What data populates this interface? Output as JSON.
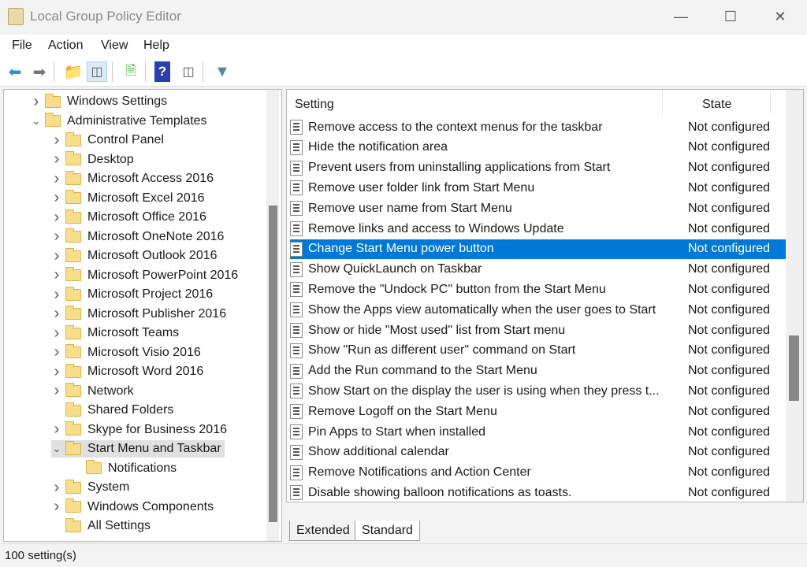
{
  "window": {
    "title": "Local Group Policy Editor",
    "icon": "policy-scroll-icon",
    "controls": [
      "minimize",
      "maximize",
      "close"
    ]
  },
  "menu": [
    {
      "label": "File"
    },
    {
      "label": "Action"
    },
    {
      "label": "View"
    },
    {
      "label": "Help"
    }
  ],
  "toolbar": [
    "back-arrow-icon",
    "forward-arrow-icon",
    "up-folder-icon",
    "show-hide-console-tree-icon",
    "export-list-icon",
    "help-icon",
    "show-action-pane-icon",
    "filter-icon"
  ],
  "tree": [
    {
      "label": "Windows Settings",
      "level": 1,
      "chev": "right"
    },
    {
      "label": "Administrative Templates",
      "level": 1,
      "chev": "down"
    },
    {
      "label": "Control Panel",
      "level": 2,
      "chev": "right"
    },
    {
      "label": "Desktop",
      "level": 2,
      "chev": "right"
    },
    {
      "label": "Microsoft Access 2016",
      "level": 2,
      "chev": "right"
    },
    {
      "label": "Microsoft Excel 2016",
      "level": 2,
      "chev": "right"
    },
    {
      "label": "Microsoft Office 2016",
      "level": 2,
      "chev": "right"
    },
    {
      "label": "Microsoft OneNote 2016",
      "level": 2,
      "chev": "right"
    },
    {
      "label": "Microsoft Outlook 2016",
      "level": 2,
      "chev": "right"
    },
    {
      "label": "Microsoft PowerPoint 2016",
      "level": 2,
      "chev": "right"
    },
    {
      "label": "Microsoft Project 2016",
      "level": 2,
      "chev": "right"
    },
    {
      "label": "Microsoft Publisher 2016",
      "level": 2,
      "chev": "right"
    },
    {
      "label": "Microsoft Teams",
      "level": 2,
      "chev": "right"
    },
    {
      "label": "Microsoft Visio 2016",
      "level": 2,
      "chev": "right"
    },
    {
      "label": "Microsoft Word 2016",
      "level": 2,
      "chev": "right"
    },
    {
      "label": "Network",
      "level": 2,
      "chev": "right"
    },
    {
      "label": "Shared Folders",
      "level": 2,
      "chev": ""
    },
    {
      "label": "Skype for Business 2016",
      "level": 2,
      "chev": "right"
    },
    {
      "label": "Start Menu and Taskbar",
      "level": 2,
      "chev": "down",
      "selected": true
    },
    {
      "label": "Notifications",
      "level": 3,
      "chev": ""
    },
    {
      "label": "System",
      "level": 2,
      "chev": "right"
    },
    {
      "label": "Windows Components",
      "level": 2,
      "chev": "right"
    },
    {
      "label": "All Settings",
      "level": 2,
      "chev": "",
      "icon": "all-settings-icon"
    }
  ],
  "list": {
    "columns": {
      "setting": "Setting",
      "state": "State"
    },
    "rows": [
      {
        "setting": "Remove access to the context menus for the taskbar",
        "state": "Not configured"
      },
      {
        "setting": "Hide the notification area",
        "state": "Not configured"
      },
      {
        "setting": "Prevent users from uninstalling applications from Start",
        "state": "Not configured"
      },
      {
        "setting": "Remove user folder link from Start Menu",
        "state": "Not configured"
      },
      {
        "setting": "Remove user name from Start Menu",
        "state": "Not configured"
      },
      {
        "setting": "Remove links and access to Windows Update",
        "state": "Not configured"
      },
      {
        "setting": "Change Start Menu power button",
        "state": "Not configured",
        "selected": true
      },
      {
        "setting": "Show QuickLaunch on Taskbar",
        "state": "Not configured"
      },
      {
        "setting": "Remove the \"Undock PC\" button from the Start Menu",
        "state": "Not configured"
      },
      {
        "setting": "Show the Apps view automatically when the user goes to Start",
        "state": "Not configured"
      },
      {
        "setting": "Show or hide \"Most used\" list from Start menu",
        "state": "Not configured"
      },
      {
        "setting": "Show \"Run as different user\" command on Start",
        "state": "Not configured"
      },
      {
        "setting": "Add the Run command to the Start Menu",
        "state": "Not configured"
      },
      {
        "setting": "Show Start on the display the user is using when they press t...",
        "state": "Not configured"
      },
      {
        "setting": "Remove Logoff on the Start Menu",
        "state": "Not configured"
      },
      {
        "setting": "Pin Apps to Start when installed",
        "state": "Not configured"
      },
      {
        "setting": "Show additional calendar",
        "state": "Not configured"
      },
      {
        "setting": "Remove Notifications and Action Center",
        "state": "Not configured"
      },
      {
        "setting": "Disable showing balloon notifications as toasts.",
        "state": "Not configured"
      }
    ]
  },
  "tabs": [
    {
      "label": "Extended"
    },
    {
      "label": "Standard",
      "active": true
    }
  ],
  "status": "100 setting(s)",
  "colors": {
    "selection": "#0078d7",
    "tree_selection": "#e0e0e0"
  }
}
